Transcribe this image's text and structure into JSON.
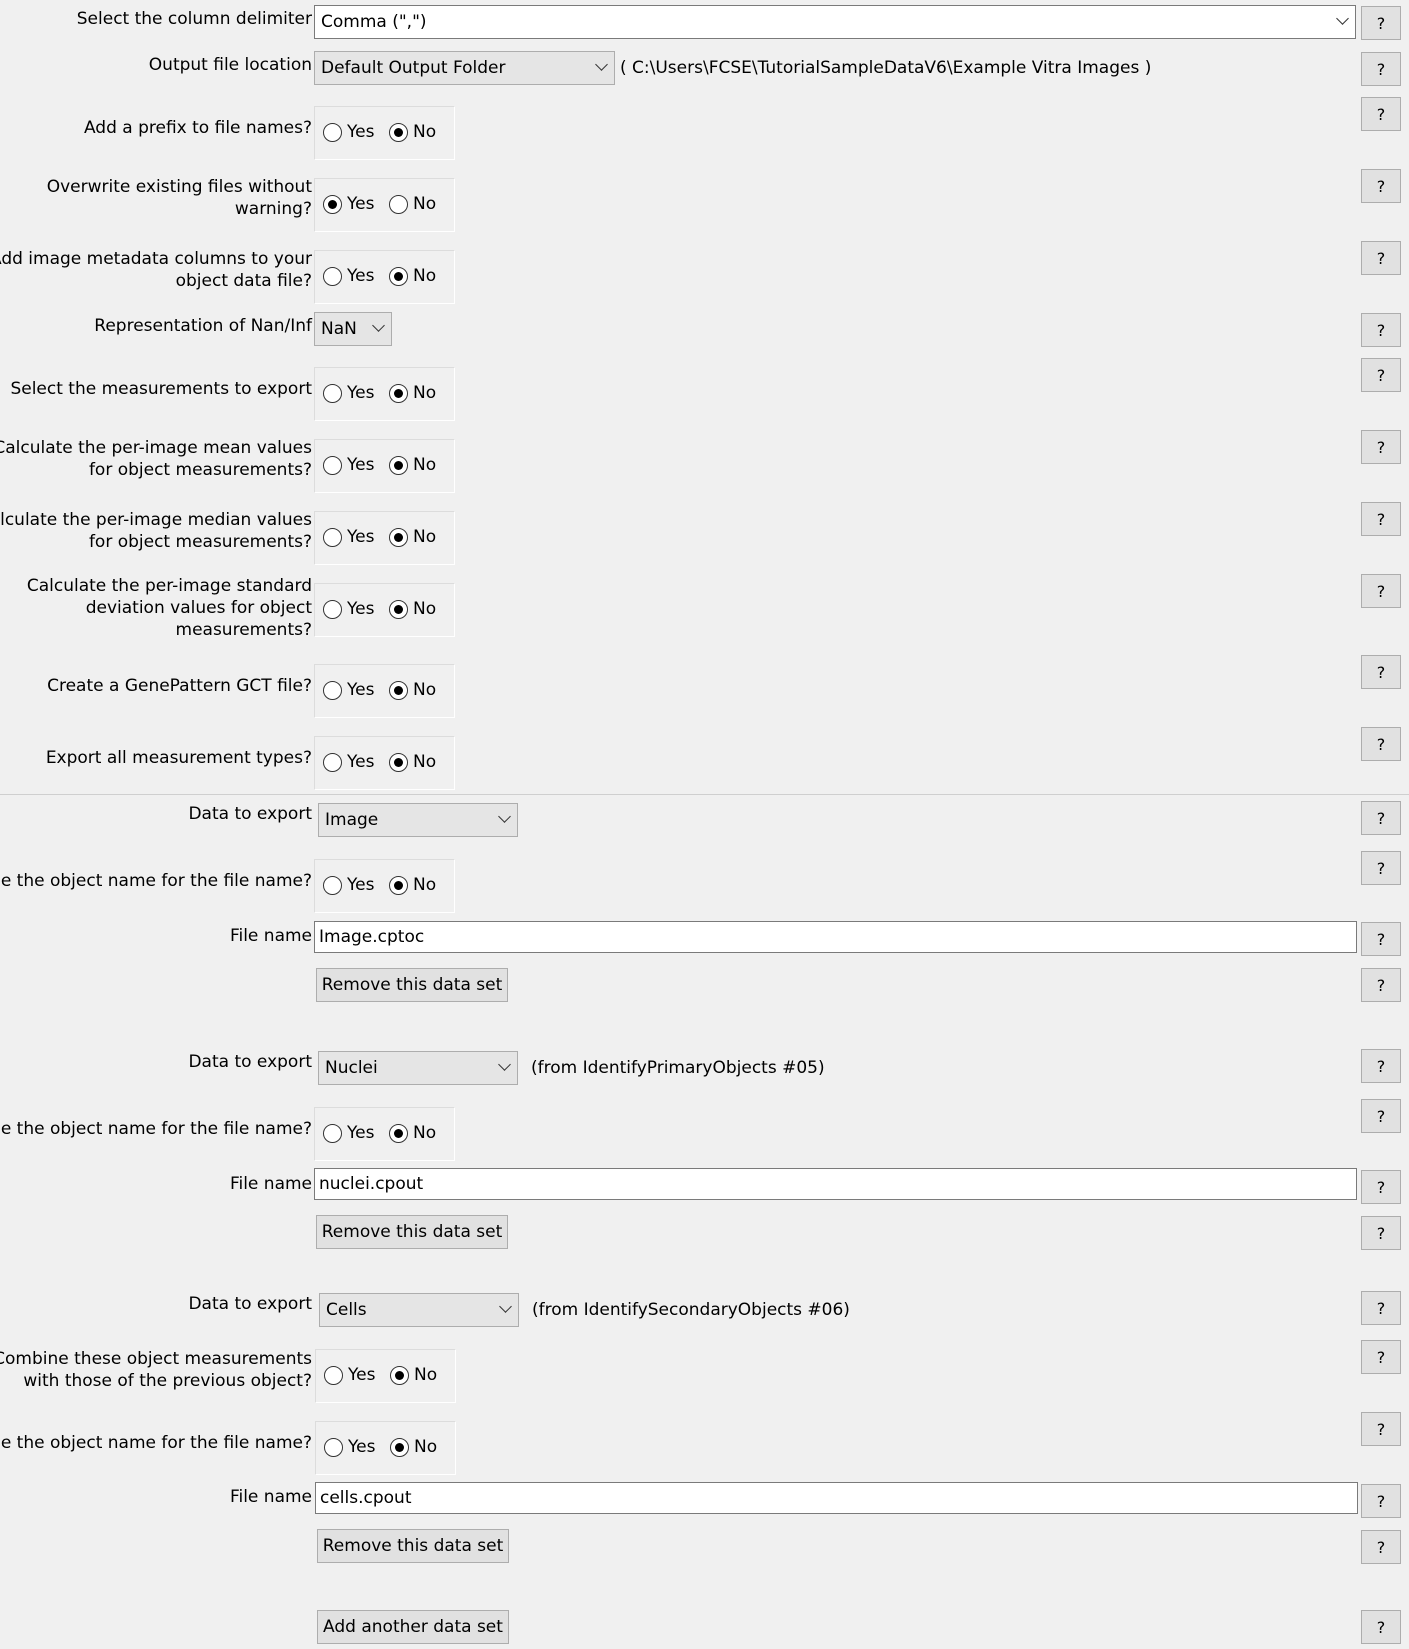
{
  "help_label": "?",
  "radio": {
    "yes": "Yes",
    "no": "No"
  },
  "delimiter": {
    "label": "Select the column delimiter",
    "value": "Comma (\",\")"
  },
  "output_location": {
    "label": "Output file location",
    "value": "Default Output Folder",
    "path": "( C:\\Users\\FCSE\\TutorialSampleDataV6\\Example Vitra Images )"
  },
  "prefix": {
    "label": "Add a prefix to file names?",
    "selected": "No"
  },
  "overwrite": {
    "label_line1": "Overwrite existing files without",
    "label_line2": "warning?",
    "selected": "Yes"
  },
  "metadata_cols": {
    "label_line1": "Add image metadata columns to your",
    "label_line2": "object data file?",
    "selected": "No"
  },
  "nan_rep": {
    "label": "Representation of Nan/Inf",
    "value": "NaN"
  },
  "select_measurements": {
    "label": "Select the measurements to export",
    "selected": "No"
  },
  "mean_values": {
    "label_line1": "Calculate the per-image mean values",
    "label_line2": "for object measurements?",
    "selected": "No"
  },
  "median_values": {
    "label_line1": "Calculate the per-image median values",
    "label_line2": "for object measurements?",
    "selected": "No"
  },
  "std_values": {
    "label_line1": "Calculate the per-image standard",
    "label_line2": "deviation values for object",
    "label_line3": "measurements?",
    "selected": "No"
  },
  "gct_file": {
    "label": "Create a GenePattern GCT file?",
    "selected": "No"
  },
  "all_types": {
    "label": "Export all measurement types?",
    "selected": "No"
  },
  "datasets": [
    {
      "data_label": "Data to export",
      "data_value": "Image",
      "from": "",
      "use_name_label": "Use the object name for the file name?",
      "use_name_selected": "No",
      "file_label": "File name",
      "file_value": "Image.cptoc",
      "remove_label": "Remove this data set"
    },
    {
      "data_label": "Data to export",
      "data_value": "Nuclei",
      "from": "(from IdentifyPrimaryObjects #05)",
      "use_name_label": "Use the object name for the file name?",
      "use_name_selected": "No",
      "file_label": "File name",
      "file_value": "nuclei.cpout",
      "remove_label": "Remove this data set"
    },
    {
      "data_label": "Data to export",
      "data_value": "Cells",
      "from": "(from IdentifySecondaryObjects #06)",
      "combine_line1": "Combine these object measurements",
      "combine_line2": "with those of the previous object?",
      "combine_selected": "No",
      "use_name_label": "Use the object name for the file name?",
      "use_name_selected": "No",
      "file_label": "File name",
      "file_value": "cells.cpout",
      "remove_label": "Remove this data set"
    }
  ],
  "add_dataset_label": "Add another data set"
}
